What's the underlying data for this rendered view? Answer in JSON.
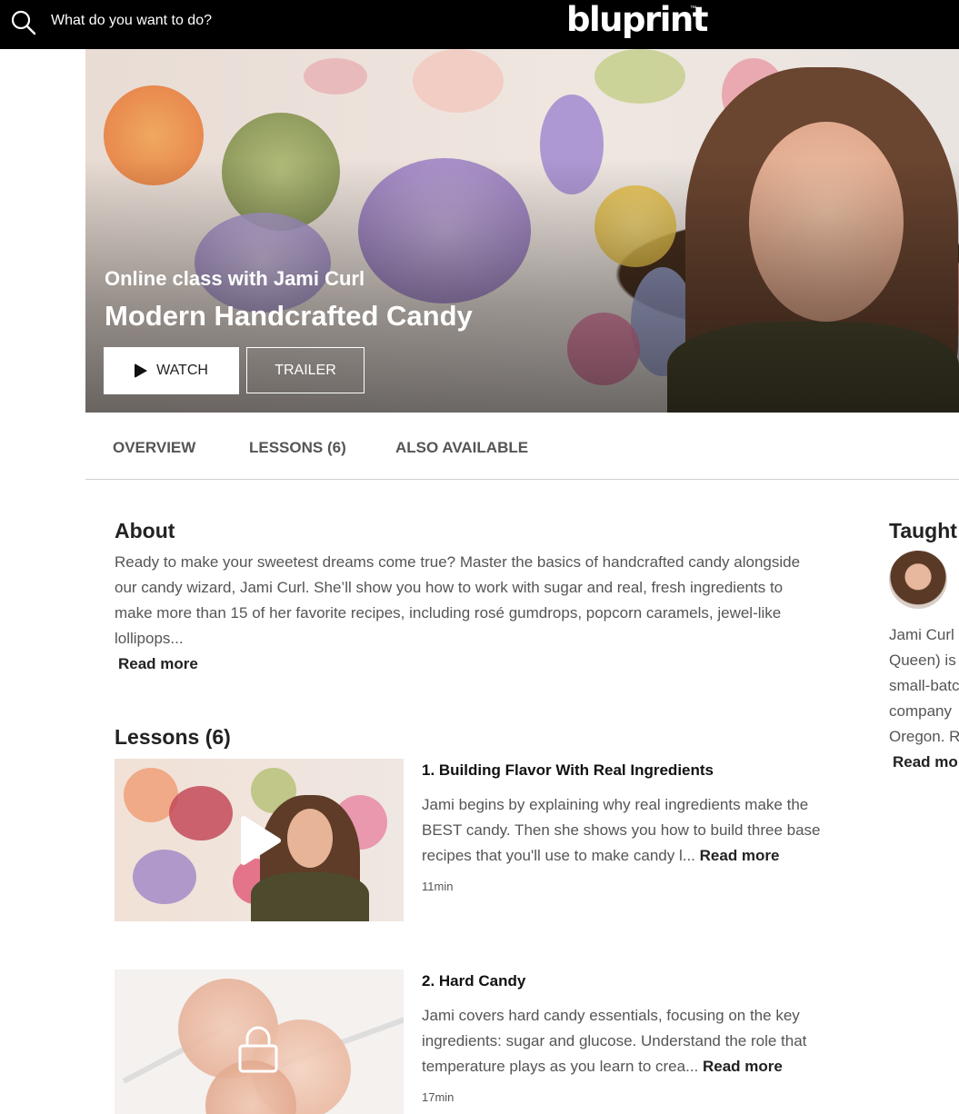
{
  "topbar": {
    "search_placeholder": "What do you want to do?",
    "logo": "bluprint",
    "logo_tm": "™"
  },
  "hero": {
    "subtitle": "Online class with Jami Curl",
    "title": "Modern Handcrafted Candy",
    "watch_label": "WATCH",
    "trailer_label": "TRAILER"
  },
  "tabs": [
    "OVERVIEW",
    "LESSONS (6)",
    "ALSO AVAILABLE"
  ],
  "about": {
    "heading": "About",
    "lines": [
      "Ready to make your sweetest dreams come true? Master the basics of handcrafted candy alongside",
      "our candy wizard, Jami Curl. She’ll show you how to work with sugar and real, fresh ingredients to",
      "make more than 15 of her favorite recipes, including rosé gumdrops, popcorn caramels, jewel-like",
      "lollipops..."
    ],
    "read_more": "Read more"
  },
  "lessons": {
    "heading": "Lessons (6)",
    "items": [
      {
        "title": "1. Building Flavor With Real Ingredients",
        "lines": [
          "Jami begins by explaining why real ingredients make the",
          "BEST candy. Then she shows you how to build three base",
          "recipes that you'll use to make candy l..."
        ],
        "read_more": "Read more",
        "duration": "11min"
      },
      {
        "title": "2. Hard Candy",
        "lines": [
          "Jami covers hard candy essentials, focusing on the key",
          "ingredients: sugar and glucose. Understand the role that",
          "temperature plays as you learn to crea..."
        ],
        "read_more": "Read more",
        "duration": "17min"
      }
    ]
  },
  "instructor": {
    "heading": "Taught",
    "bio_lines": [
      "Jami Curl (",
      "Queen) is",
      "small-batc",
      "company",
      "Oregon. R"
    ],
    "read_more": "Read mo"
  }
}
